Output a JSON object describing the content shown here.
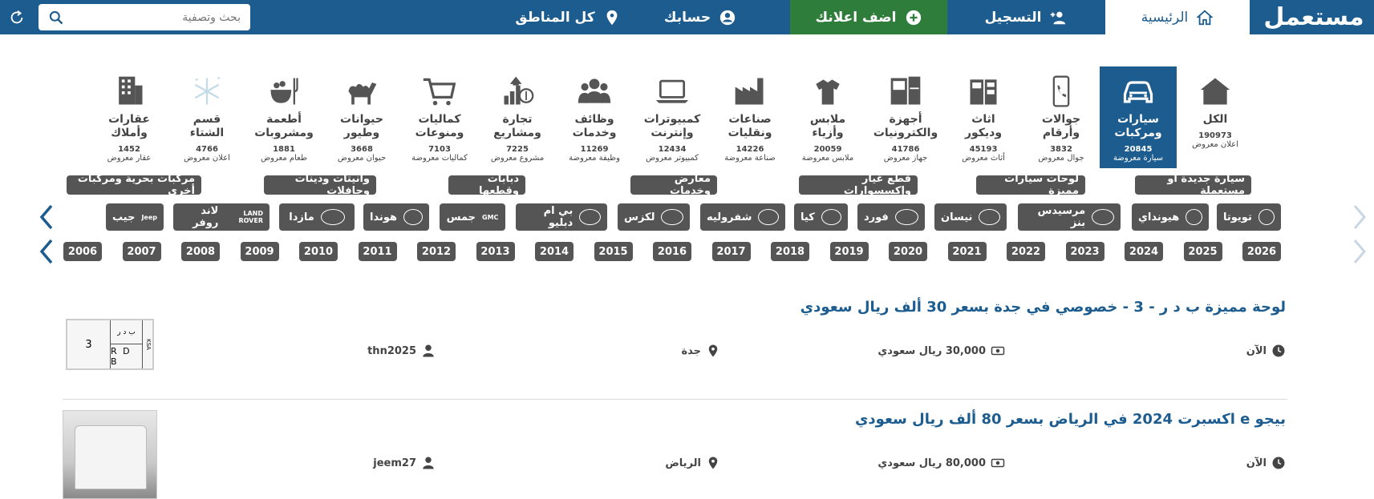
{
  "brand": {
    "logo": "مستعمل"
  },
  "nav": {
    "home": "الرئيسية",
    "register": "التسجيل",
    "add_ad": "اضف اعلانك",
    "account": "حسابك",
    "regions": "كل المناطق"
  },
  "search": {
    "placeholder": "بحث وتصفية"
  },
  "categories": [
    {
      "label": "الكل",
      "count": "190973",
      "unit": "اعلان معروض",
      "icon": "house-icon"
    },
    {
      "label": "سيارات\nومركبات",
      "count": "20845",
      "unit": "سيارة معروضة",
      "icon": "car-icon",
      "active": true
    },
    {
      "label": "جوالات\nوأرقام",
      "count": "3832",
      "unit": "جوال معروض",
      "icon": "phone-icon"
    },
    {
      "label": "اثاث\nوديكور",
      "count": "45193",
      "unit": "أثاث معروض",
      "icon": "furniture-icon"
    },
    {
      "label": "أجهزة\nوالكترونيات",
      "count": "41786",
      "unit": "جهاز معروض",
      "icon": "appliances-icon"
    },
    {
      "label": "ملابس\nوأزياء",
      "count": "20059",
      "unit": "ملابس معروضة",
      "icon": "clothes-icon"
    },
    {
      "label": "صناعات\nونقليات",
      "count": "14226",
      "unit": "صناعة معروضة",
      "icon": "factory-icon"
    },
    {
      "label": "كمبيوترات\nوإنترنت",
      "count": "12434",
      "unit": "كمبيوتر معروض",
      "icon": "laptop-icon"
    },
    {
      "label": "وظائف\nوخدمات",
      "count": "11269",
      "unit": "وظيفة معروضة",
      "icon": "people-icon"
    },
    {
      "label": "تجارة\nومشاريع",
      "count": "7225",
      "unit": "مشروع معروض",
      "icon": "money-growth-icon"
    },
    {
      "label": "كماليات\nومنوعات",
      "count": "7103",
      "unit": "كماليات معروضة",
      "icon": "cart-icon"
    },
    {
      "label": "حيوانات\nوطيور",
      "count": "3668",
      "unit": "حيوان معروض",
      "icon": "camel-icon"
    },
    {
      "label": "أطعمة\nومشروبات",
      "count": "1881",
      "unit": "طعام معروض",
      "icon": "food-icon"
    },
    {
      "label": "قسم\nالشتاء",
      "count": "4766",
      "unit": "اعلان معروض",
      "icon": "snow-icon"
    },
    {
      "label": "عقارات\nوأملاك",
      "count": "1452",
      "unit": "عقار معروض",
      "icon": "building-icon"
    }
  ],
  "tags": [
    "سيارة جديدة أو مستعملة",
    "لوحات سيارات مميزة",
    "قطع غيار وإكسسوارات",
    "معارض وخدمات",
    "دبابات وقطعها",
    "وانيتات ودينات وحافلات",
    "مركبات بحرية ومركبات أخرى"
  ],
  "car_brands": [
    "تويوتا",
    "هيونداي",
    "مرسيدس بنز",
    "نيسان",
    "فورد",
    "كيا",
    "شفروليه",
    "لكزس",
    "بي ام دبليو",
    "جمس",
    "هوندا",
    "مازدا",
    "لاند روفر",
    "جيب"
  ],
  "brand_icon_text": {
    "gmc": "GMC",
    "jeep": "Jeep",
    "landrover": "LAND ROVER"
  },
  "years": [
    "2026",
    "2025",
    "2024",
    "2023",
    "2022",
    "2021",
    "2020",
    "2019",
    "2018",
    "2017",
    "2016",
    "2015",
    "2014",
    "2013",
    "2012",
    "2011",
    "2010",
    "2009",
    "2008",
    "2007",
    "2006"
  ],
  "listings": [
    {
      "title": "لوحة مميزة ب د ر - 3 - خصوصي في جدة بسعر 30 ألف ريال سعودي",
      "time": "الآن",
      "price": "30,000 ريال سعودي",
      "city": "جدة",
      "user": "thn2025",
      "plate": {
        "num": "3",
        "ar": "ب د ر",
        "en": "R D B",
        "ksa": "KSA"
      }
    },
    {
      "title": "بيجو e اكسبرت 2024 في الرياض بسعر 80 ألف ريال سعودي",
      "time": "الآن",
      "price": "80,000 ريال سعودي",
      "city": "الرياض",
      "user": "jeem27"
    }
  ],
  "colors": {
    "primary": "#1c5c8f",
    "add_button": "#2e7d3a",
    "chip": "#555555"
  }
}
